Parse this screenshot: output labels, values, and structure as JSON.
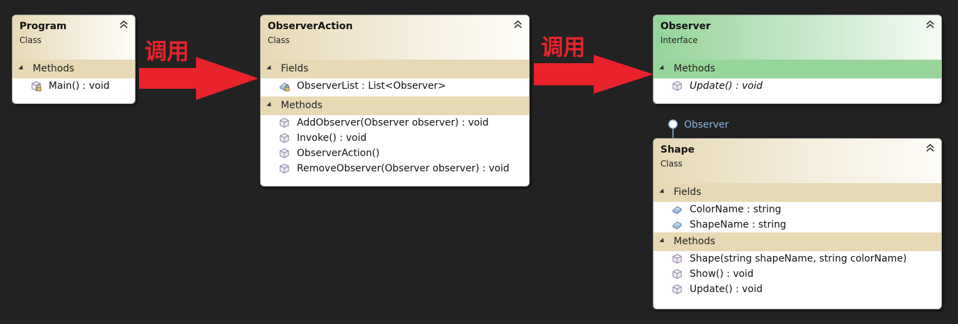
{
  "program": {
    "title": "Program",
    "stereotype": "Class",
    "sections": [
      {
        "label": "Methods",
        "members": [
          {
            "text": "Main() : void",
            "icon": "private-method-icon"
          }
        ]
      }
    ]
  },
  "observer_action": {
    "title": "ObserverAction",
    "stereotype": "Class",
    "fields_label": "Fields",
    "fields": [
      {
        "text": "ObserverList : List<Observer>",
        "icon": "private-field-icon"
      }
    ],
    "methods_label": "Methods",
    "methods": [
      {
        "text": "AddObserver(Observer observer) : void"
      },
      {
        "text": "Invoke() : void"
      },
      {
        "text": "ObserverAction()"
      },
      {
        "text": "RemoveObserver(Observer observer) : void"
      }
    ]
  },
  "observer": {
    "title": "Observer",
    "stereotype": "Interface",
    "methods_label": "Methods",
    "methods": [
      {
        "text": "Update() : void"
      }
    ]
  },
  "shape": {
    "title": "Shape",
    "stereotype": "Class",
    "lollipop_label": "Observer",
    "fields_label": "Fields",
    "fields": [
      {
        "text": "ColorName : string"
      },
      {
        "text": "ShapeName : string"
      }
    ],
    "methods_label": "Methods",
    "methods": [
      {
        "text": "Shape(string shapeName, string colorName)"
      },
      {
        "text": "Show() : void"
      },
      {
        "text": "Update() : void"
      }
    ]
  },
  "arrows": [
    {
      "label": "调用"
    },
    {
      "label": "调用"
    }
  ],
  "colors": {
    "background": "#222222",
    "class_header": "#e6d9b3",
    "interface_header": "#98d598",
    "arrow": "#e8232b",
    "lollipop": "#8ab4de"
  }
}
